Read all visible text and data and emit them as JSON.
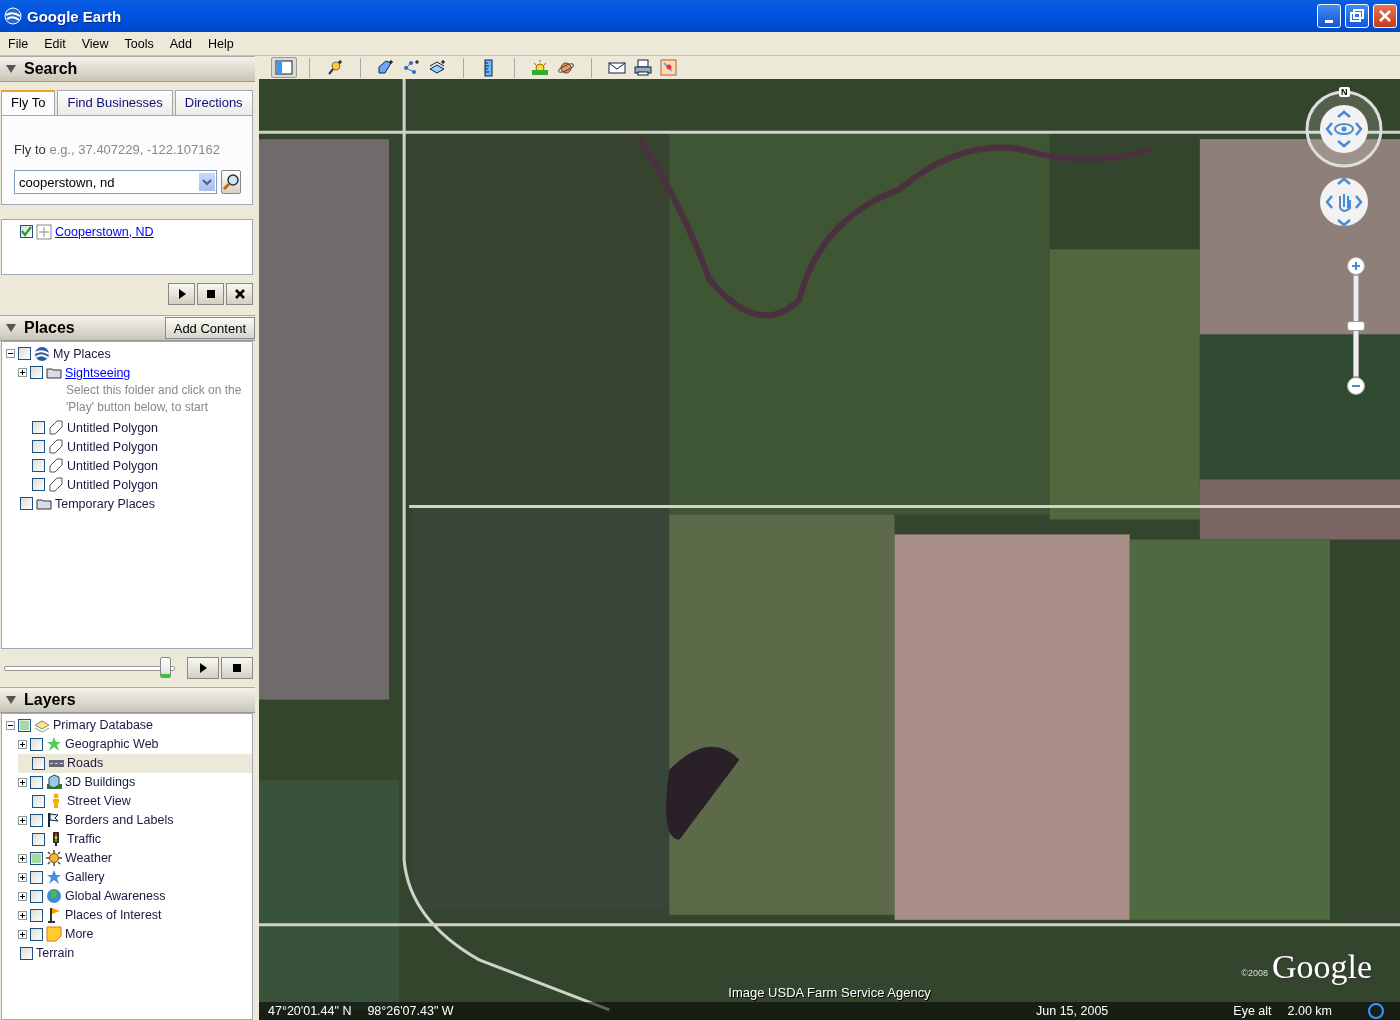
{
  "window": {
    "title": "Google Earth"
  },
  "menu": [
    "File",
    "Edit",
    "View",
    "Tools",
    "Add",
    "Help"
  ],
  "search": {
    "title": "Search",
    "expanded": true,
    "tabs": [
      {
        "label": "Fly To",
        "selected": true
      },
      {
        "label": "Find Businesses",
        "selected": false
      },
      {
        "label": "Directions",
        "selected": false
      }
    ],
    "hint_label": "Fly to",
    "hint_example": "e.g., 37.407229, -122.107162",
    "value": "cooperstown, nd",
    "results": [
      {
        "label": "Cooperstown, ND",
        "checked": true
      }
    ]
  },
  "places": {
    "title": "Places",
    "expanded": true,
    "add_button": "Add Content",
    "tree": [
      {
        "label": "My Places",
        "kind": "earth",
        "checked": false,
        "selected": false,
        "expanded": true,
        "children": [
          {
            "label": "Sightseeing",
            "kind": "folder",
            "checked": false,
            "selected": false,
            "expanded": false,
            "link": true,
            "description": "Select this folder and click on the 'Play' button below, to start"
          },
          {
            "label": "Untitled Polygon",
            "kind": "polygon",
            "checked": false,
            "selected": false
          },
          {
            "label": "Untitled Polygon",
            "kind": "polygon",
            "checked": false,
            "selected": false
          },
          {
            "label": "Untitled Polygon",
            "kind": "polygon",
            "checked": false,
            "selected": false
          },
          {
            "label": "Untitled Polygon",
            "kind": "polygon",
            "checked": false,
            "selected": false
          }
        ]
      },
      {
        "label": "Temporary Places",
        "kind": "folder",
        "checked": false,
        "selected": false
      }
    ],
    "tour_slider": {
      "level": 0.97
    }
  },
  "layers": {
    "title": "Layers",
    "expanded": true,
    "tree": [
      {
        "label": "Primary Database",
        "kind": "layers",
        "checked": false,
        "partial": true,
        "selected": false,
        "expanded": true,
        "children": [
          {
            "label": "Geographic Web",
            "kind": "star",
            "checked": false,
            "selected": false,
            "expanded": false
          },
          {
            "label": "Roads",
            "kind": "road",
            "checked": false,
            "selected": true
          },
          {
            "label": "3D Buildings",
            "kind": "building",
            "checked": false,
            "selected": false,
            "expanded": false
          },
          {
            "label": "Street View",
            "kind": "person",
            "checked": false,
            "selected": false
          },
          {
            "label": "Borders and Labels",
            "kind": "flag",
            "checked": false,
            "selected": false,
            "expanded": false
          },
          {
            "label": "Traffic",
            "kind": "traffic",
            "checked": false,
            "selected": false
          },
          {
            "label": "Weather",
            "kind": "sun",
            "checked": false,
            "partial": true,
            "selected": false,
            "expanded": false
          },
          {
            "label": "Gallery",
            "kind": "bluestar",
            "checked": false,
            "selected": false,
            "expanded": false
          },
          {
            "label": "Global Awareness",
            "kind": "globe",
            "checked": false,
            "selected": false,
            "expanded": false
          },
          {
            "label": "Places of Interest",
            "kind": "pin",
            "checked": false,
            "selected": false,
            "expanded": false
          },
          {
            "label": "More",
            "kind": "note",
            "checked": false,
            "selected": false,
            "expanded": false
          }
        ]
      },
      {
        "label": "Terrain",
        "kind": "none",
        "checked": false,
        "selected": false
      }
    ]
  },
  "map": {
    "compass_label": "N",
    "zoom": {
      "level": 0.5
    },
    "attribution": "Image USDA Farm Service Agency",
    "copyright": "©2008",
    "logo": "Google",
    "latitude": "47°20'01.44\" N",
    "longitude": "98°26'07.43\" W",
    "date": "Jun 15, 2005",
    "eye_alt_label": "Eye alt",
    "eye_alt": "2.00 km"
  }
}
